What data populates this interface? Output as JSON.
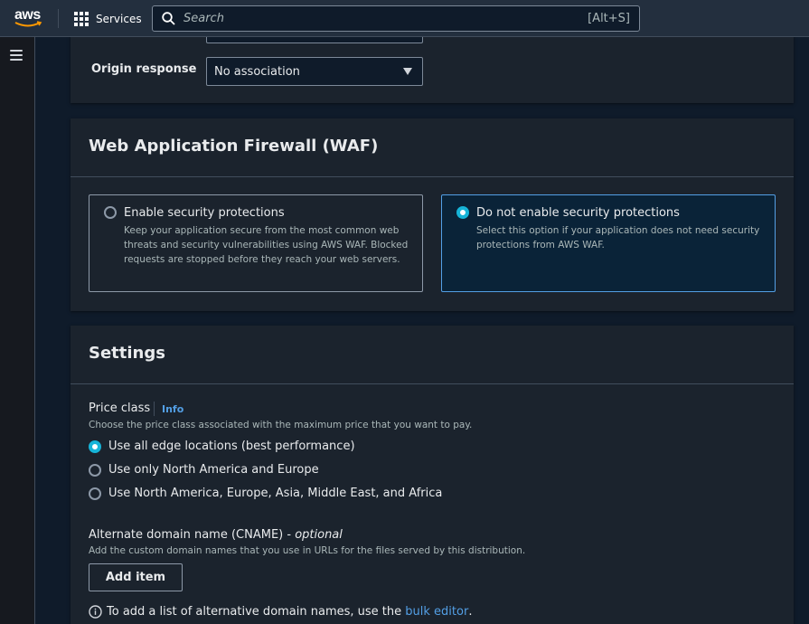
{
  "nav": {
    "logo_text": "aws",
    "services_label": "Services",
    "search_placeholder": "Search",
    "search_shortcut": "[Alt+S]"
  },
  "origin_section": {
    "origin_response_label": "Origin response",
    "origin_response_value": "No association"
  },
  "waf": {
    "title": "Web Application Firewall (WAF)",
    "options": [
      {
        "title": "Enable security protections",
        "description": "Keep your application secure from the most common web threats and security vulnerabilities using AWS WAF. Blocked requests are stopped before they reach your web servers.",
        "selected": false
      },
      {
        "title": "Do not enable security protections",
        "description": "Select this option if your application does not need security protections from AWS WAF.",
        "selected": true
      }
    ]
  },
  "settings": {
    "title": "Settings",
    "price_class": {
      "label": "Price class",
      "info": "Info",
      "description": "Choose the price class associated with the maximum price that you want to pay.",
      "options": [
        {
          "label": "Use all edge locations (best performance)",
          "selected": true
        },
        {
          "label": "Use only North America and Europe",
          "selected": false
        },
        {
          "label": "Use North America, Europe, Asia, Middle East, and Africa",
          "selected": false
        }
      ]
    },
    "cname": {
      "label": "Alternate domain name (CNAME) - ",
      "label_optional": "optional",
      "description": "Add the custom domain names that you use in URLs for the files served by this distribution.",
      "add_button": "Add item",
      "note_prefix": "To add a list of alternative domain names, use the ",
      "note_link": "bulk editor",
      "note_suffix": "."
    }
  },
  "colors": {
    "accent": "#539fe5",
    "radio_selected": "#16b4d8",
    "nav_bg": "#232f3e",
    "panel_bg": "#1b232d"
  }
}
